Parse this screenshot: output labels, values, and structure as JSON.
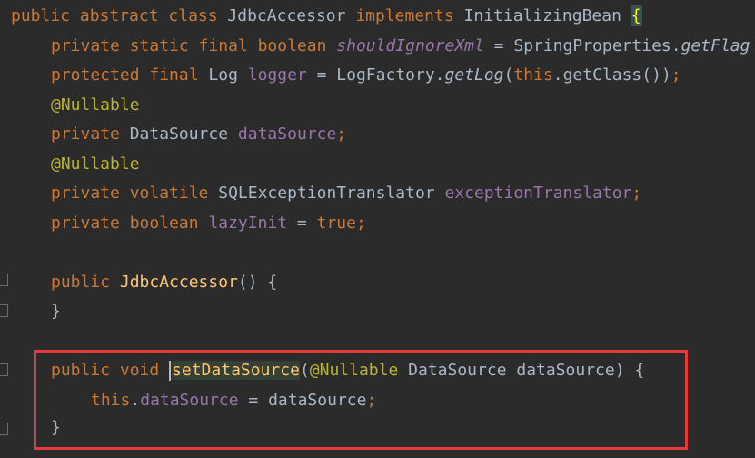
{
  "code": {
    "line1": {
      "kw1": "public abstract class ",
      "cls": "JdbcAccessor ",
      "kw2": "implements ",
      "iface": "InitializingBean ",
      "brace": "{"
    },
    "line2": {
      "kw": "private static final boolean ",
      "field": "shouldIgnoreXml",
      "eq": " = SpringProperties.",
      "call": "getFlag"
    },
    "line3": {
      "kw1": "protected final ",
      "type": "Log ",
      "field": "logger",
      "eq": " = LogFactory.",
      "call": "getLog",
      "p1": "(",
      "kw2": "this",
      "rest": ".getClass())",
      "semi": ";"
    },
    "line4": {
      "ann": "@Nullable"
    },
    "line5": {
      "kw": "private ",
      "type": "DataSource ",
      "field": "dataSource",
      "semi": ";"
    },
    "line6": {
      "ann": "@Nullable"
    },
    "line7": {
      "kw": "private volatile ",
      "type": "SQLExceptionTranslator ",
      "field": "exceptionTranslator",
      "semi": ";"
    },
    "line8": {
      "kw": "private boolean ",
      "field": "lazyInit",
      "eq": " = ",
      "val": "true",
      "semi": ";"
    },
    "line10": {
      "kw": "public ",
      "ctor": "JdbcAccessor",
      "rest": "() {"
    },
    "line11": {
      "brace": "}"
    },
    "line13": {
      "kw": "public void ",
      "method": "setDataSource",
      "p1": "(",
      "ann": "@Nullable ",
      "rest": "DataSource dataSource) {"
    },
    "line14": {
      "kw": "this",
      "dot": ".",
      "field": "dataSource",
      "eq": " = dataSource",
      "semi": ";"
    },
    "line15": {
      "brace": "}"
    }
  },
  "colors": {
    "background": "#2b2b2b",
    "keyword": "#cc7832",
    "field": "#9876aa",
    "annotation": "#bbb529",
    "method": "#ffc66d",
    "highlight_box": "#e63a3a"
  }
}
